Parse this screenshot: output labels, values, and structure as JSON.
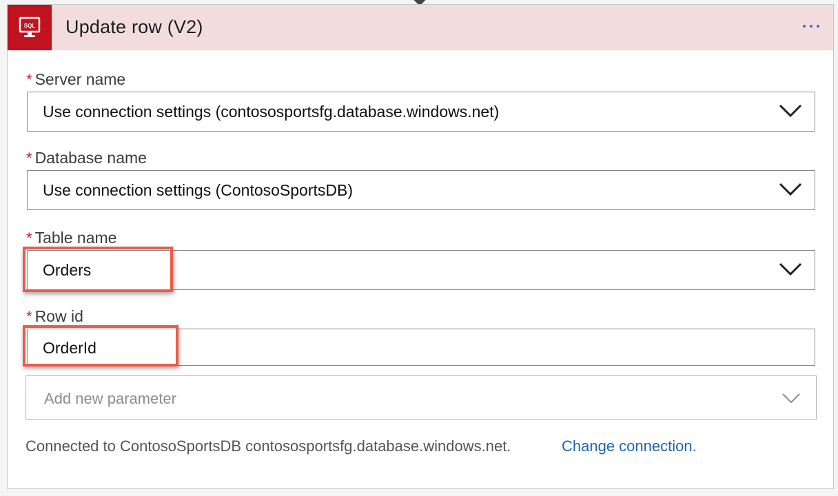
{
  "header": {
    "icon": "sql-database-icon",
    "icon_text": "SQL",
    "title": "Update row (V2)",
    "more_icon": "ellipsis-icon",
    "bg_color": "#f3dcdd",
    "icon_color": "#c1121f"
  },
  "fields": {
    "server": {
      "required_marker": "*",
      "label": "Server name",
      "value": "Use connection settings (contososportsfg.database.windows.net)"
    },
    "database": {
      "required_marker": "*",
      "label": "Database name",
      "value": "Use connection settings (ContosoSportsDB)"
    },
    "table": {
      "required_marker": "*",
      "label": "Table name",
      "value": "Orders"
    },
    "row_id": {
      "required_marker": "*",
      "label": "Row id",
      "value": "OrderId"
    }
  },
  "add_parameter": {
    "placeholder": "Add new parameter"
  },
  "footer": {
    "connection_text": "Connected to ContosoSportsDB contososportsfg.database.windows.net.",
    "change_link": "Change connection."
  },
  "colors": {
    "required": "#d0192f",
    "link": "#1f64b8",
    "highlight": "#ef5b4a"
  }
}
